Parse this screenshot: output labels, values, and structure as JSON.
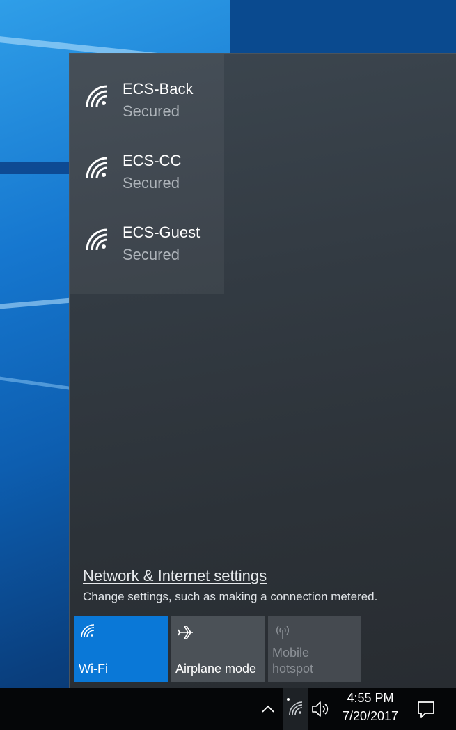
{
  "networks": [
    {
      "name": "ECS-Back",
      "status": "Secured",
      "icon": "wifi-signal-icon"
    },
    {
      "name": "ECS-CC",
      "status": "Secured",
      "icon": "wifi-signal-icon"
    },
    {
      "name": "ECS-Guest",
      "status": "Secured",
      "icon": "wifi-signal-icon"
    }
  ],
  "settings": {
    "link": "Network & Internet settings",
    "description": "Change settings, such as making a connection metered."
  },
  "quick_actions": [
    {
      "label": "Wi-Fi",
      "icon": "wifi-icon",
      "state": "on"
    },
    {
      "label": "Airplane mode",
      "icon": "airplane-icon",
      "state": "off"
    },
    {
      "label_line1": "Mobile",
      "label_line2": "hotspot",
      "icon": "hotspot-icon",
      "state": "disabled"
    }
  ],
  "taskbar": {
    "time": "4:55 PM",
    "date": "7/20/2017",
    "icons": [
      "chevron-up-icon",
      "network-wifi-icon",
      "volume-icon",
      "action-center-icon"
    ]
  },
  "colors": {
    "accent": "#0a78d7",
    "flyout_bg": "#333b43",
    "taskbar_bg": "#050608",
    "secondary_text": "#aeb4ba"
  }
}
